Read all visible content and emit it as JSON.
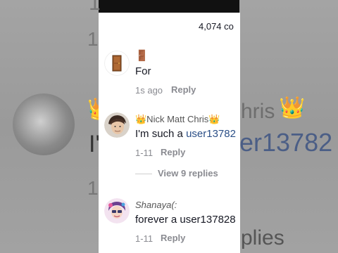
{
  "background": {
    "text_top": "1",
    "text_row2": "1",
    "text_name": "hris",
    "text_initial": "I'",
    "text_user": "er13782",
    "text_row4": "1",
    "text_replies": "plies"
  },
  "sheet": {
    "comment_count": "4,074 co",
    "comments": [
      {
        "author": "🚪",
        "text": "For",
        "time": "1s ago",
        "reply_label": "Reply",
        "avatar_icon": "door-icon"
      },
      {
        "author": "👑Nick Matt Chris👑",
        "text_prefix": "I'm such a ",
        "mention": "user13782",
        "time": "1-11",
        "reply_label": "Reply",
        "view_replies": "View 9 replies",
        "avatar_icon": "person-photo"
      },
      {
        "author": "Shanaya(:",
        "text": "forever a user137828",
        "time": "1-11",
        "reply_label": "Reply",
        "avatar_icon": "cartoon-avatar"
      }
    ]
  },
  "colors": {
    "mention": "#2b4f87",
    "muted": "#8a8b91",
    "text": "#161823"
  }
}
